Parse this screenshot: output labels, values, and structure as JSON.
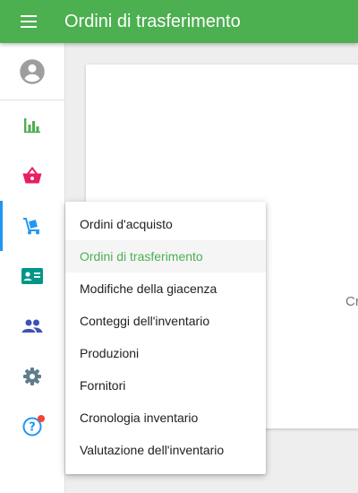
{
  "header": {
    "title": "Ordini di trasferimento",
    "menu_icon": "hamburger-menu-icon"
  },
  "sidebar": {
    "items": [
      {
        "name": "account",
        "icon": "account-circle-icon"
      },
      {
        "name": "reports",
        "icon": "bar-chart-icon"
      },
      {
        "name": "sales",
        "icon": "basket-icon"
      },
      {
        "name": "inventory",
        "icon": "dolly-icon",
        "active": true
      },
      {
        "name": "customers",
        "icon": "id-card-icon"
      },
      {
        "name": "employees",
        "icon": "people-icon"
      },
      {
        "name": "settings",
        "icon": "gear-icon"
      },
      {
        "name": "help",
        "icon": "help-icon",
        "has_notification": true
      }
    ]
  },
  "main": {
    "card_text": "Cr"
  },
  "inventory_menu": {
    "items": [
      {
        "label": "Ordini d'acquisto"
      },
      {
        "label": "Ordini di trasferimento",
        "selected": true
      },
      {
        "label": "Modifiche della giacenza"
      },
      {
        "label": "Conteggi dell'inventario"
      },
      {
        "label": "Produzioni"
      },
      {
        "label": "Fornitori"
      },
      {
        "label": "Cronologia inventario"
      },
      {
        "label": "Valutazione dell'inventario"
      }
    ]
  },
  "colors": {
    "appbar": "#4caf50",
    "accent_selected": "#4caf50",
    "active_indicator": "#2196f3",
    "reports_icon": "#4caf50",
    "sales_icon": "#e91e63",
    "inventory_icon": "#2196f3",
    "customers_icon": "#009688",
    "employees_icon": "#3f51b5",
    "settings_icon": "#607d8b",
    "help_icon": "#2196f3",
    "notification": "#f44336"
  }
}
